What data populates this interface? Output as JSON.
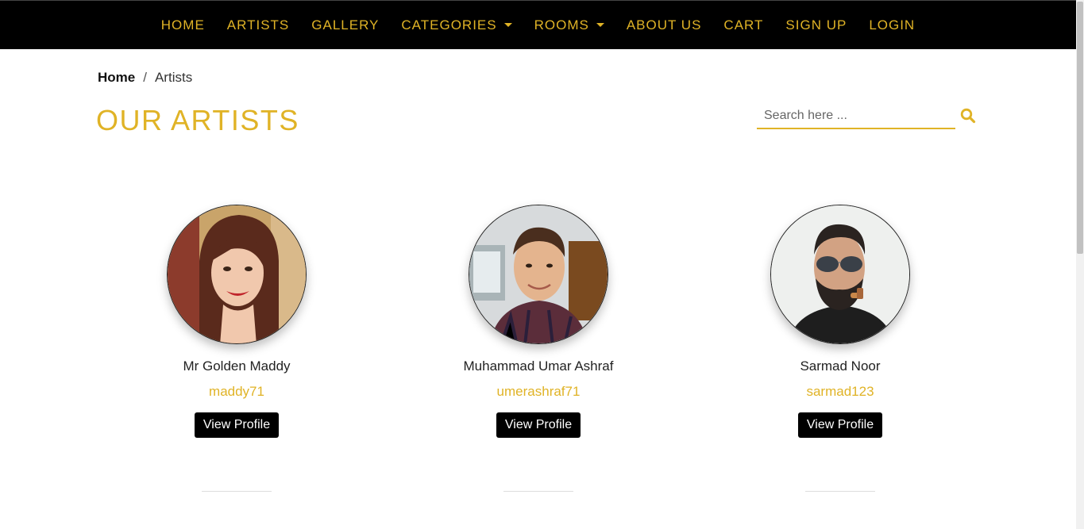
{
  "nav": {
    "items": [
      {
        "label": "HOME",
        "dropdown": false
      },
      {
        "label": "ARTISTS",
        "dropdown": false
      },
      {
        "label": "GALLERY",
        "dropdown": false
      },
      {
        "label": "CATEGORIES",
        "dropdown": true
      },
      {
        "label": "ROOMS",
        "dropdown": true
      },
      {
        "label": "ABOUT US",
        "dropdown": false
      },
      {
        "label": "CART",
        "dropdown": false
      },
      {
        "label": "SIGN UP",
        "dropdown": false
      },
      {
        "label": "LOGIN",
        "dropdown": false
      }
    ]
  },
  "breadcrumb": {
    "home": "Home",
    "separator": "/",
    "current": "Artists"
  },
  "page": {
    "title": "OUR ARTISTS"
  },
  "search": {
    "placeholder": "Search here ...",
    "value": "",
    "icon": "search-icon"
  },
  "artists": [
    {
      "name": "Mr Golden Maddy",
      "username": "maddy71",
      "button": "View Profile"
    },
    {
      "name": "Muhammad Umar Ashraf",
      "username": "umerashraf71",
      "button": "View Profile"
    },
    {
      "name": "Sarmad Noor",
      "username": "sarmad123",
      "button": "View Profile"
    }
  ],
  "colors": {
    "accent": "#e0b326",
    "nav_bg": "#000000",
    "button_bg": "#000000",
    "button_text": "#ffffff"
  }
}
